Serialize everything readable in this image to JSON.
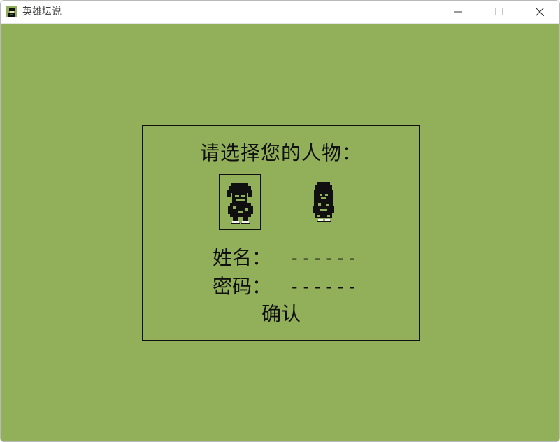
{
  "window": {
    "title": "英雄坛说",
    "app_icon": "hero-portrait-icon",
    "controls": [
      "minimize-icon",
      "maximize-icon",
      "close-icon"
    ]
  },
  "colors": {
    "background": "#92b05a",
    "ink": "#101010",
    "titlebar": "#ffffff"
  },
  "panel": {
    "prompt": "请选择您的人物：",
    "characters": [
      {
        "id": "male",
        "icon": "male-hero-sprite-icon",
        "selected": true
      },
      {
        "id": "female",
        "icon": "female-hero-sprite-icon",
        "selected": false
      }
    ],
    "name_label": "姓名：",
    "name_value": "------",
    "password_label": "密码：",
    "password_value": "------",
    "confirm_label": "确认"
  }
}
